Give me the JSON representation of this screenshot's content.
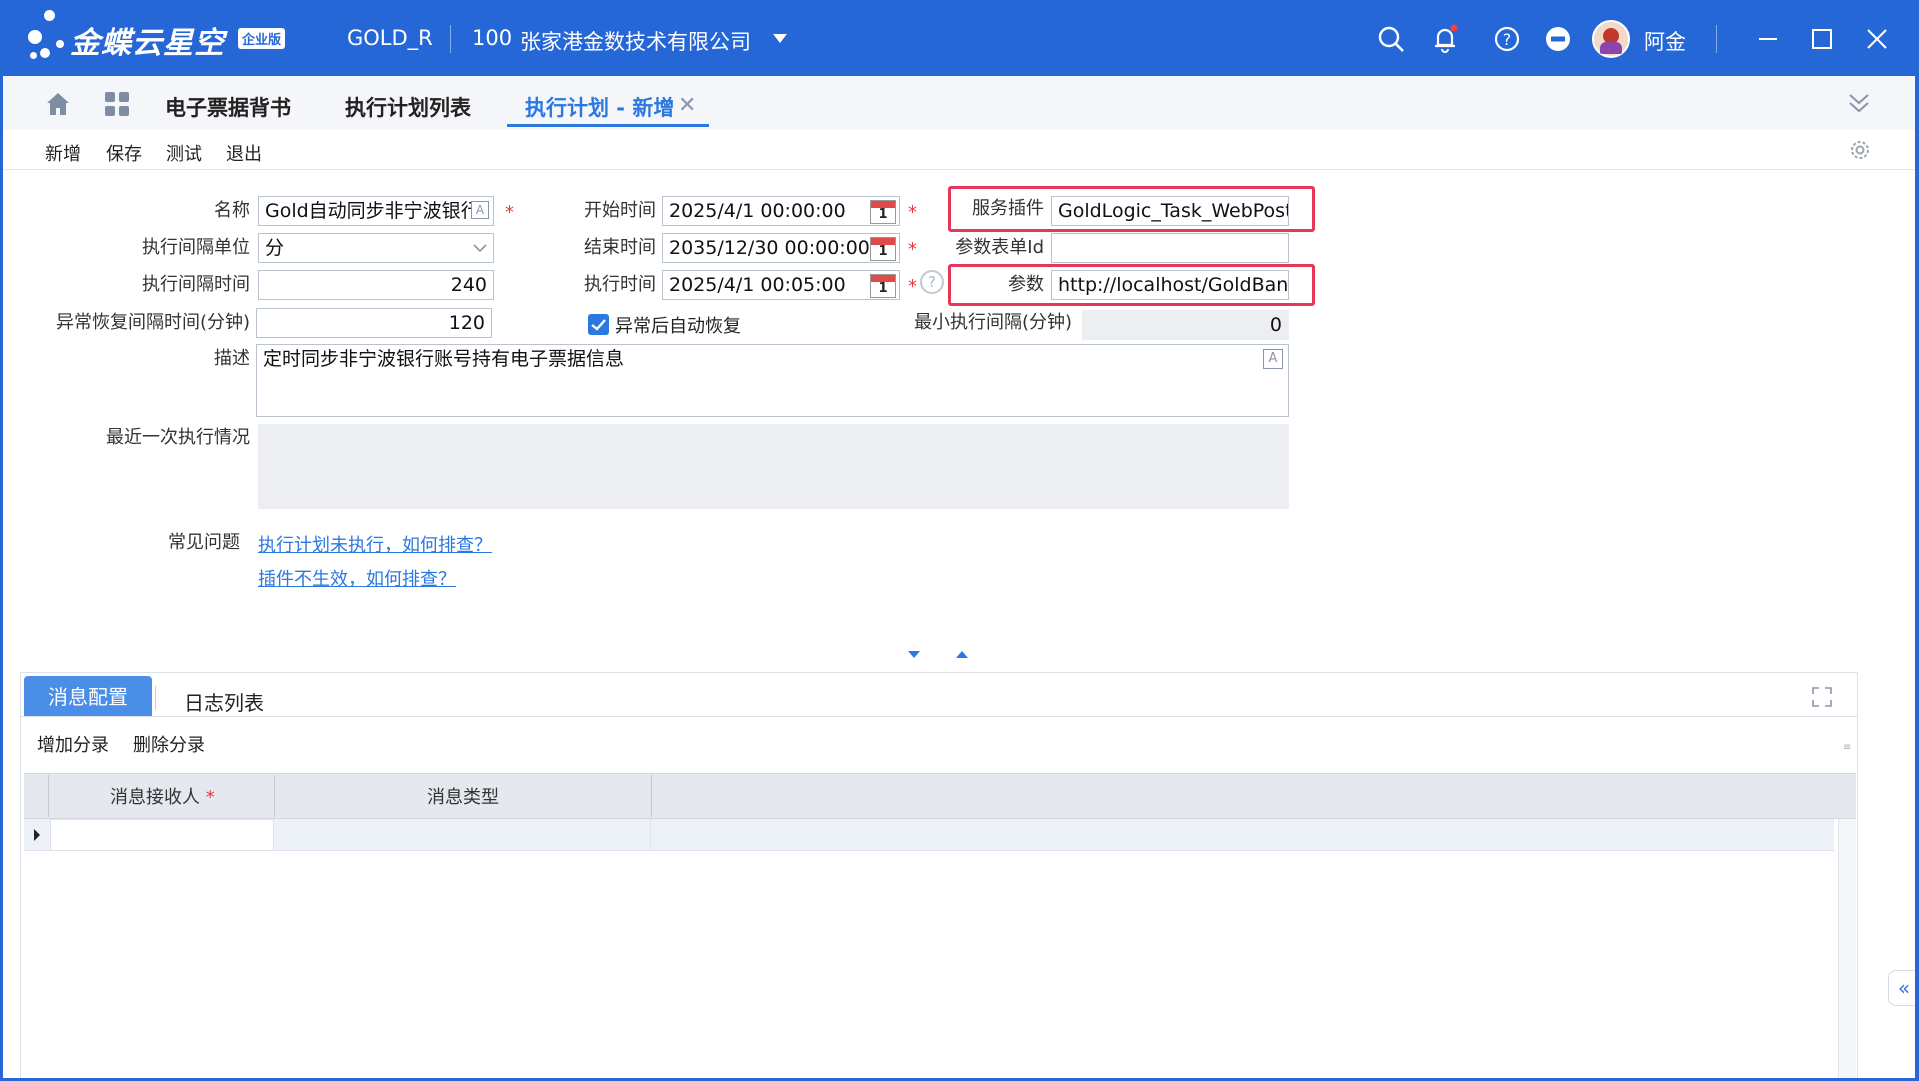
{
  "app": {
    "logo_text": "金蝶云星空",
    "logo_badge": "企业版",
    "database": "GOLD_R",
    "org_code": "100",
    "org_name": "张家港金数技术有限公司",
    "user_name": "阿金"
  },
  "tabs": [
    {
      "label": "电子票据背书"
    },
    {
      "label": "执行计划列表"
    },
    {
      "label": "执行计划 - 新增"
    }
  ],
  "toolbar": {
    "new_label": "新增",
    "save_label": "保存",
    "test_label": "测试",
    "exit_label": "退出"
  },
  "form": {
    "name_label": "名称",
    "name_value": "Gold自动同步非宁波银行",
    "interval_unit_label": "执行间隔单位",
    "interval_unit_value": "分",
    "interval_time_label": "执行间隔时间",
    "interval_time_value": "240",
    "recover_interval_label": "异常恢复间隔时间(分钟)",
    "recover_interval_value": "120",
    "start_time_label": "开始时间",
    "start_time_value": "2025/4/1 00:00:00",
    "end_time_label": "结束时间",
    "end_time_value": "2035/12/30 00:00:00",
    "exec_time_label": "执行时间",
    "exec_time_value": "2025/4/1 00:05:00",
    "auto_recover_label": "异常后自动恢复",
    "auto_recover_checked": true,
    "service_plugin_label": "服务插件",
    "service_plugin_value": "GoldLogic_Task_WebPost.G",
    "param_form_id_label": "参数表单Id",
    "param_form_id_value": "",
    "param_label": "参数",
    "param_value": "http://localhost/GoldBank/",
    "min_interval_label": "最小执行间隔(分钟)",
    "min_interval_value": "0",
    "desc_label": "描述",
    "desc_value": "定时同步非宁波银行账号持有电子票据信息",
    "last_exec_label": "最近一次执行情况",
    "last_exec_value": "",
    "faq_label": "常见问题",
    "faq_link1": "执行计划未执行，如何排查？",
    "faq_link2": "插件不生效，如何排查？"
  },
  "bottom": {
    "tab_active": "消息配置",
    "tab_other": "日志列表",
    "add_entry": "增加分录",
    "delete_entry": "删除分录",
    "col_receiver": "消息接收人",
    "col_type": "消息类型"
  },
  "colors": {
    "titlebar": "#2567d6",
    "accent": "#2a78e0",
    "required": "#e23b3b",
    "highlight_box": "#e6375a"
  },
  "icons": [
    "search-icon",
    "bell-icon",
    "help-icon",
    "minus-circle-icon",
    "avatar",
    "minimize-icon",
    "maximize-icon",
    "close-icon",
    "home-icon",
    "apps-icon",
    "chevron-double-down-icon",
    "gear-icon",
    "calendar-icon",
    "expand-icon",
    "collapse-left-icon"
  ]
}
